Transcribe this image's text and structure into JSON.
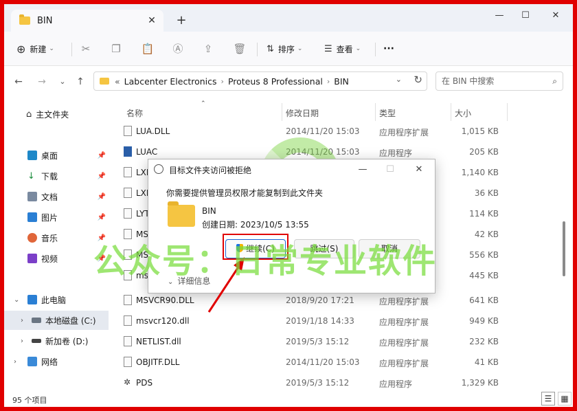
{
  "tab": {
    "title": "BIN"
  },
  "toolbar": {
    "new_label": "新建",
    "sort_label": "排序",
    "view_label": "查看",
    "more_label": "···"
  },
  "address": {
    "prefix": "«",
    "crumbs": [
      "Labcenter Electronics",
      "Proteus 8 Professional",
      "BIN"
    ]
  },
  "search": {
    "placeholder": "在 BIN 中搜索"
  },
  "sidebar": {
    "home": "主文件夹",
    "items": [
      "桌面",
      "下载",
      "文档",
      "图片",
      "音乐",
      "视频"
    ],
    "pc": "此电脑",
    "drives": [
      "本地磁盘 (C:)",
      "新加卷 (D:)"
    ],
    "network": "网络"
  },
  "columns": {
    "name": "名称",
    "date": "修改日期",
    "type": "类型",
    "size": "大小"
  },
  "files": [
    {
      "name": "LUA.DLL",
      "date": "2014/11/20 15:03",
      "type": "应用程序扩展",
      "size": "1,015 KB"
    },
    {
      "name": "LUAC",
      "date": "2014/11/20 15:03",
      "type": "应用程序",
      "size": "205 KB"
    },
    {
      "name": "LXLC",
      "date": "",
      "type": "",
      "size": "1,140 KB"
    },
    {
      "name": "LXLC",
      "date": "",
      "type": "",
      "size": "36 KB"
    },
    {
      "name": "LYTO",
      "date": "",
      "type": "",
      "size": "114 KB"
    },
    {
      "name": "MSC",
      "date": "",
      "type": "",
      "size": "42 KB"
    },
    {
      "name": "MSV",
      "date": "",
      "type": "",
      "size": "556 KB"
    },
    {
      "name": "msv",
      "date": "",
      "type": "",
      "size": "445 KB"
    },
    {
      "name": "MSVCR90.DLL",
      "date": "2018/9/20 17:21",
      "type": "应用程序扩展",
      "size": "641 KB"
    },
    {
      "name": "msvcr120.dll",
      "date": "2019/1/18 14:33",
      "type": "应用程序扩展",
      "size": "949 KB"
    },
    {
      "name": "NETLIST.dll",
      "date": "2019/5/3 15:12",
      "type": "应用程序扩展",
      "size": "232 KB"
    },
    {
      "name": "OBJITF.DLL",
      "date": "2014/11/20 15:03",
      "type": "应用程序扩展",
      "size": "41 KB"
    },
    {
      "name": "PDS",
      "date": "2019/5/3 15:12",
      "type": "应用程序",
      "size": "1,329 KB"
    }
  ],
  "status": {
    "count": "95 个项目"
  },
  "dialog": {
    "title": "目标文件夹访问被拒绝",
    "message": "你需要提供管理员权限才能复制到此文件夹",
    "folder_name": "BIN",
    "folder_date": "创建日期: 2023/10/5 13:55",
    "continue": "继续(C)",
    "skip": "跳过(S)",
    "cancel": "取消",
    "details": "详细信息"
  },
  "watermark": {
    "text": "公众号：日常专业软件"
  },
  "colors": {
    "frame": "#e00000",
    "watermark": "#78dc3c",
    "accent": "#1c66d6"
  }
}
